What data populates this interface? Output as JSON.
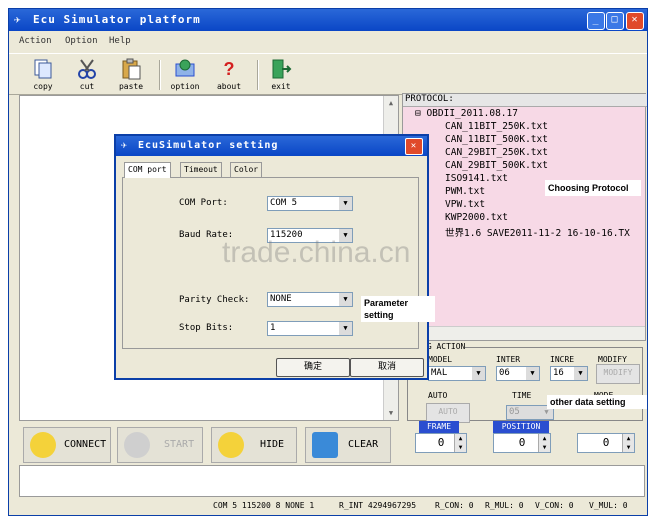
{
  "window": {
    "title": "Ecu Simulator platform",
    "controls": [
      "minimize",
      "maximize",
      "close"
    ]
  },
  "menu": [
    "Action",
    "Option",
    "Help"
  ],
  "toolbar": [
    {
      "label": "copy",
      "icon": "copy-icon"
    },
    {
      "label": "cut",
      "icon": "cut-icon"
    },
    {
      "label": "paste",
      "icon": "paste-icon"
    },
    {
      "label": "option",
      "icon": "option-icon"
    },
    {
      "label": "about",
      "icon": "about-icon"
    },
    {
      "label": "exit",
      "icon": "exit-icon"
    }
  ],
  "protocol": {
    "header": "PROTOCOL:",
    "root": "OBDII_2011.08.17",
    "items": [
      "CAN_11BIT_250K.txt",
      "CAN_11BIT_500K.txt",
      "CAN_29BIT_250K.txt",
      "CAN_29BIT_500K.txt",
      "ISO9141.txt",
      "PWM.txt",
      "VPW.txt",
      "KWP2000.txt",
      "世界1.6 SAVE2011-11-2 16-10-16.TX"
    ]
  },
  "notes": {
    "protocol": "Choosing Protocol",
    "parameter": "Parameter setting",
    "other": "other data setting"
  },
  "debug": {
    "group_label": "UG ACTION",
    "model_label": "MODEL",
    "model_value": "MAL",
    "inter_label": "INTER",
    "inter_value": "06",
    "incre_label": "INCRE",
    "incre_value": "16",
    "modify_label": "MODIFY",
    "modify_button": "MODIFY",
    "auto_label": "AUTO",
    "auto_button": "AUTO",
    "time_label": "TIME",
    "time_value": "05",
    "mode_label": "MODE",
    "frame_label": "FRAME",
    "frame_value": "0",
    "position_label": "POSITION",
    "position_value": "0",
    "mode_value": "0"
  },
  "buttons": {
    "connect": "CONNECT",
    "start": "START",
    "hide": "HIDE",
    "clear": "CLEAR"
  },
  "status": {
    "port": "COM 5 115200 8 NONE 1",
    "r_int": "R_INT 4294967295",
    "r_con": "R_CON: 0",
    "r_mul": "R_MUL: 0",
    "v_con": "V_CON: 0",
    "v_mul": "V_MUL: 0"
  },
  "dialog": {
    "title": "EcuSimulator setting",
    "tabs": [
      "COM port",
      "Timeout",
      "Color"
    ],
    "com_port_label": "COM Port:",
    "com_port_value": "COM 5",
    "baud_label": "Baud Rate:",
    "baud_value": "115200",
    "parity_label": "Parity Check:",
    "parity_value": "NONE",
    "stop_label": "Stop Bits:",
    "stop_value": "1",
    "ok": "确定",
    "cancel": "取消"
  },
  "watermark": "trade.china.cn",
  "colors": {
    "titlebar": "#0a46c6",
    "protocol_bg": "#f7d9e6",
    "blue_label": "#2a4ed0"
  }
}
